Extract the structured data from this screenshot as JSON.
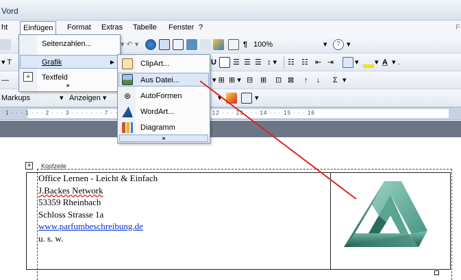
{
  "window": {
    "title": "Vord"
  },
  "menubar": {
    "items": [
      "ht",
      "Einfügen",
      "Format",
      "Extras",
      "Tabelle",
      "Fenster",
      "?"
    ],
    "right_edge": "F"
  },
  "toolbar": {
    "zoom": "100%"
  },
  "reviewing": {
    "markups": "Markups",
    "anzeigen": "Anzeigen"
  },
  "einfuegen_menu": {
    "items": [
      {
        "label": "Seitenzahlen...",
        "icon": "none"
      },
      {
        "label": "Grafik",
        "icon": "none",
        "submenu_arrow": "▶"
      },
      {
        "label": "Textfeld",
        "icon": "textbox-icon"
      }
    ],
    "expand": "»"
  },
  "grafik_submenu": {
    "items": [
      {
        "label": "ClipArt...",
        "icon": "clipart-icon"
      },
      {
        "label": "Aus Datei...",
        "icon": "picture-icon"
      },
      {
        "label": "AutoFormen",
        "icon": "autoshapes-icon"
      },
      {
        "label": "WordArt...",
        "icon": "wordart-icon"
      },
      {
        "label": "Diagramm",
        "icon": "chart-icon"
      }
    ],
    "expand": "»"
  },
  "ruler": {
    "numbers": "1 · · · 1 · · · 2 · · · 3 · · · · · · · 7 · · · 8 · · · 9 · · · 10 · · · 11 · · · 12 · · · 13 · · · 14 · · · 15 · · · 16"
  },
  "document": {
    "header_label": "Kopfzeile",
    "lines": [
      "Office Lernen - Leicht & Einfach",
      "J.Backes Network",
      "53359 Rheinbach",
      "Schloss Strasse 1a",
      "www.parfumbeschreibung.de",
      "u. s. w."
    ]
  },
  "colors": {
    "accent": "#d8261e",
    "highlight": "#dce8f8"
  }
}
